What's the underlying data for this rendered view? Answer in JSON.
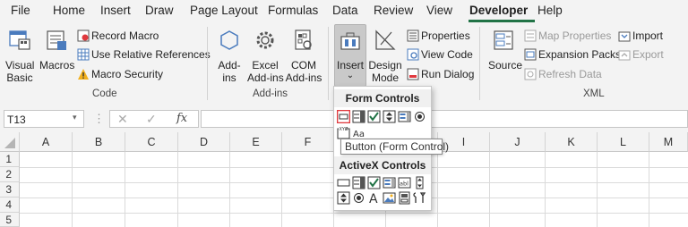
{
  "menu": {
    "tabs": [
      "File",
      "Home",
      "Insert",
      "Draw",
      "Page Layout",
      "Formulas",
      "Data",
      "Review",
      "View",
      "Developer",
      "Help"
    ],
    "active_tab": "Developer"
  },
  "ribbon": {
    "code": {
      "visual_basic": [
        "Visual",
        "Basic"
      ],
      "macros": "Macros",
      "record_macro": "Record Macro",
      "use_relative_references": "Use Relative References",
      "macro_security": "Macro Security",
      "group_label": "Code"
    },
    "addins": {
      "addins": [
        "Add-",
        "ins"
      ],
      "excel_addins": [
        "Excel",
        "Add-ins"
      ],
      "com_addins": [
        "COM",
        "Add-ins"
      ],
      "group_label": "Add-ins"
    },
    "controls": {
      "insert": "Insert",
      "insert_arrow": "⌄",
      "design_mode": [
        "Design",
        "Mode"
      ],
      "properties": "Properties",
      "view_code": "View Code",
      "run_dialog": "Run Dialog"
    },
    "xml": {
      "source": "Source",
      "map_properties": "Map Properties",
      "expansion_packs": "Expansion Packs",
      "refresh_data": "Refresh Data",
      "import": "Import",
      "export": "Export",
      "group_label": "XML"
    }
  },
  "formula_bar": {
    "name_box": "T13",
    "fx": "fx",
    "formula": ""
  },
  "grid": {
    "columns": [
      "A",
      "B",
      "C",
      "D",
      "E",
      "F",
      "G",
      "H",
      "I",
      "J",
      "K",
      "L",
      "M"
    ],
    "rows": [
      "1",
      "2",
      "3",
      "4",
      "5"
    ]
  },
  "insert_menu": {
    "form_controls_title": "Form Controls",
    "activex_controls_title": "ActiveX Controls",
    "tooltip": "Button (Form Control)",
    "form_controls": [
      "Button",
      "Combo Box",
      "Check Box",
      "Spin Button",
      "List Box",
      "Option Button",
      "Group Box",
      "Label",
      "Scroll Bar",
      "Text Field",
      "Combo List - Edit",
      "Combo Drop-Down - Edit"
    ],
    "activex_controls": [
      "Command Button",
      "Combo Box",
      "Check Box",
      "List Box",
      "Text Box",
      "Scroll Bar",
      "Spin Button",
      "Option Button",
      "Label",
      "Image",
      "Toggle Button",
      "More Controls"
    ]
  },
  "colors": {
    "accent": "#217346",
    "selection_border": "#e0393e",
    "ribbon_bg": "#f3f3f3"
  }
}
